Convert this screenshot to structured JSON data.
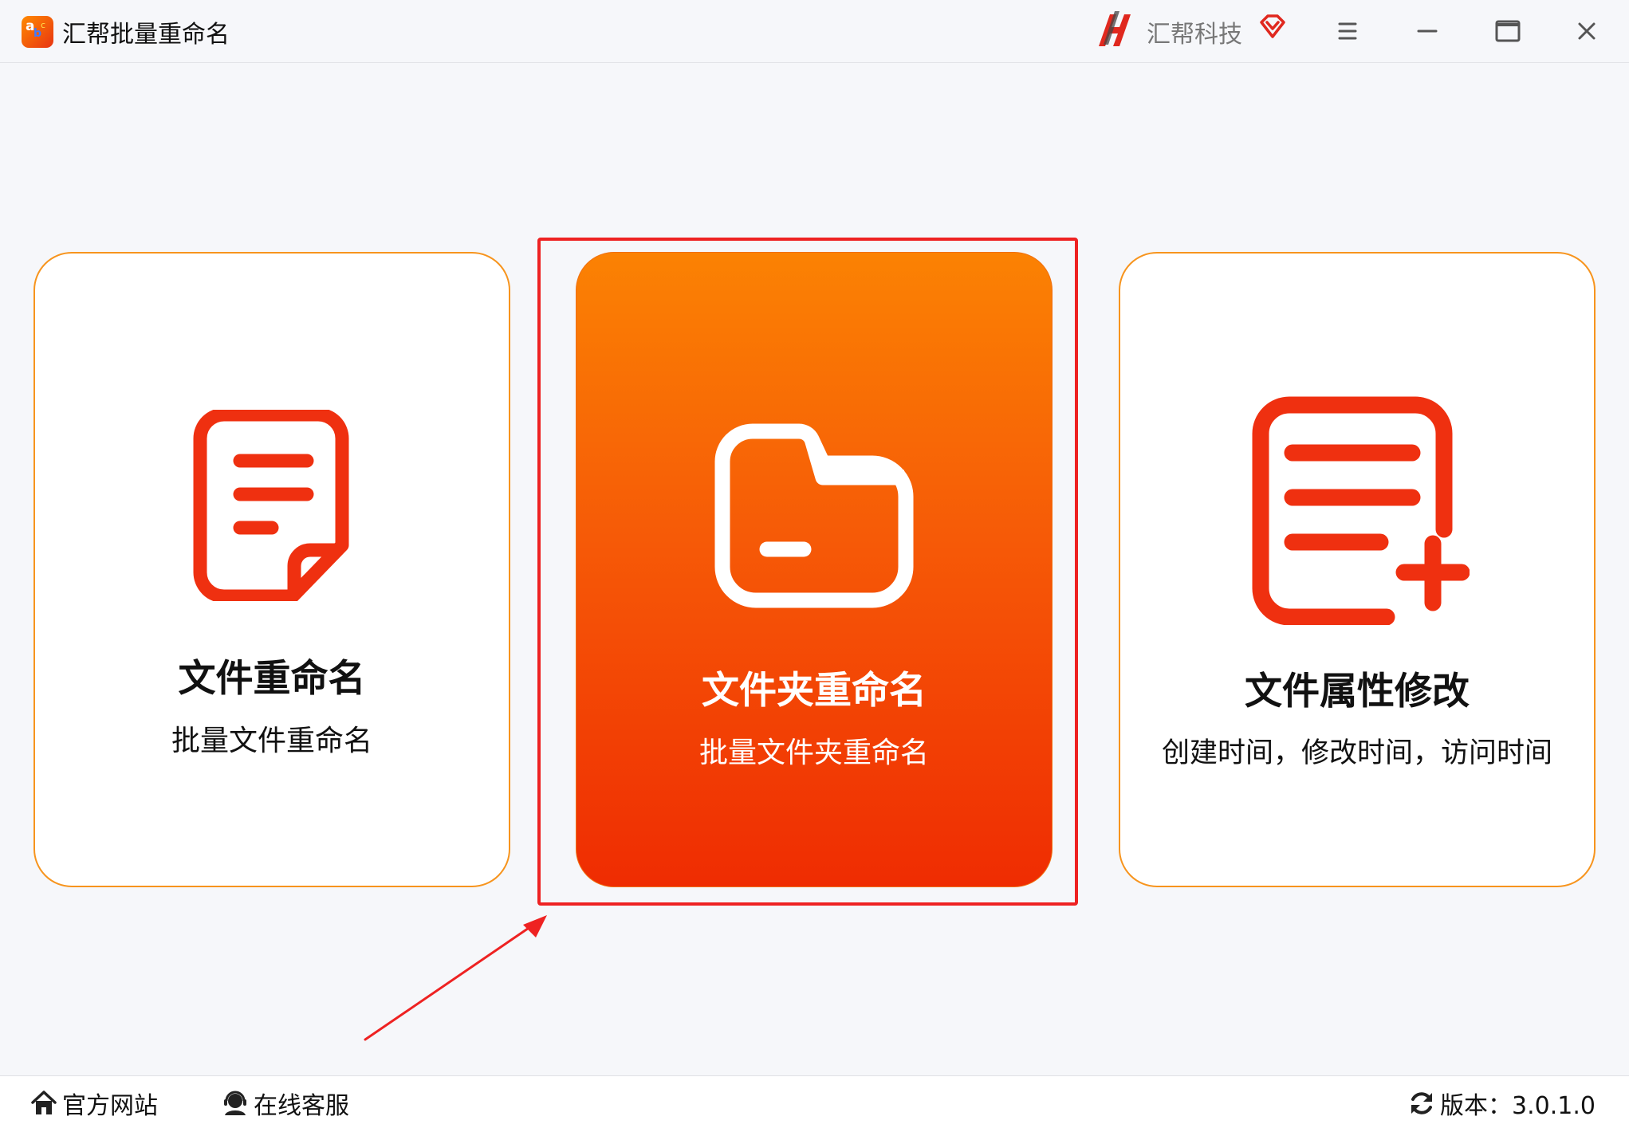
{
  "window": {
    "title": "汇帮批量重命名",
    "brand_name": "汇帮科技",
    "accent_color": "#f7941d",
    "highlight_color": "#ee2222"
  },
  "cards": [
    {
      "title": "文件重命名",
      "subtitle": "批量文件重命名",
      "icon": "document-icon"
    },
    {
      "title": "文件夹重命名",
      "subtitle": "批量文件夹重命名",
      "icon": "folder-icon",
      "selected": true
    },
    {
      "title": "文件属性修改",
      "subtitle": "创建时间，修改时间，访问时间",
      "icon": "document-add-icon"
    }
  ],
  "footer": {
    "website": "官方网站",
    "support": "在线客服",
    "version": "版本：3.0.1.0"
  }
}
